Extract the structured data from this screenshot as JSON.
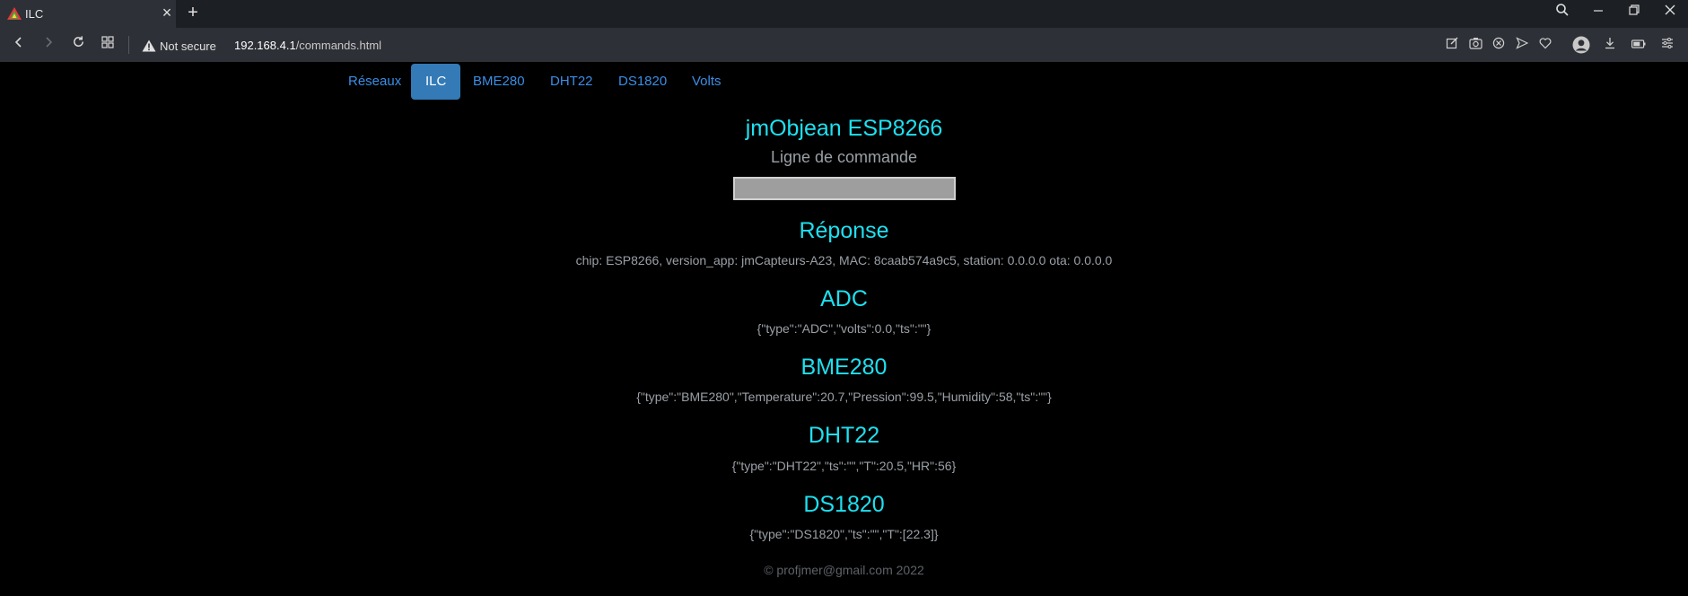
{
  "browser": {
    "tab_title": "ILC",
    "tab_close": "×",
    "new_tab": "+",
    "not_secure": "Not secure",
    "url_host": "192.168.4.1",
    "url_path": "/commands.html"
  },
  "nav": {
    "tabs": [
      {
        "label": "Réseaux",
        "active": false
      },
      {
        "label": "ILC",
        "active": true
      },
      {
        "label": "BME280",
        "active": false
      },
      {
        "label": "DHT22",
        "active": false
      },
      {
        "label": "DS1820",
        "active": false
      },
      {
        "label": "Volts",
        "active": false
      }
    ]
  },
  "main": {
    "title": "jmObjean ESP8266",
    "subtitle": "Ligne de commande",
    "command_value": "",
    "response_heading": "Réponse",
    "response_text": "chip: ESP8266, version_app: jmCapteurs-A23, MAC: 8caab574a9c5, station: 0.0.0.0 ota: 0.0.0.0",
    "sections": [
      {
        "heading": "ADC",
        "data": "{\"type\":\"ADC\",\"volts\":0.0,\"ts\":\"\"}"
      },
      {
        "heading": "BME280",
        "data": "{\"type\":\"BME280\",\"Temperature\":20.7,\"Pression\":99.5,\"Humidity\":58,\"ts\":\"\"}"
      },
      {
        "heading": "DHT22",
        "data": "{\"type\":\"DHT22\",\"ts\":\"\",\"T\":20.5,\"HR\":56}"
      },
      {
        "heading": "DS1820",
        "data": "{\"type\":\"DS1820\",\"ts\":\"\",\"T\":[22.3]}"
      }
    ],
    "footer": "© profjmer@gmail.com 2022"
  },
  "colors": {
    "accent": "#1ee0f0",
    "active_tab": "#337ab7",
    "link": "#3a8ee6",
    "text_muted": "#9aa0a6"
  }
}
